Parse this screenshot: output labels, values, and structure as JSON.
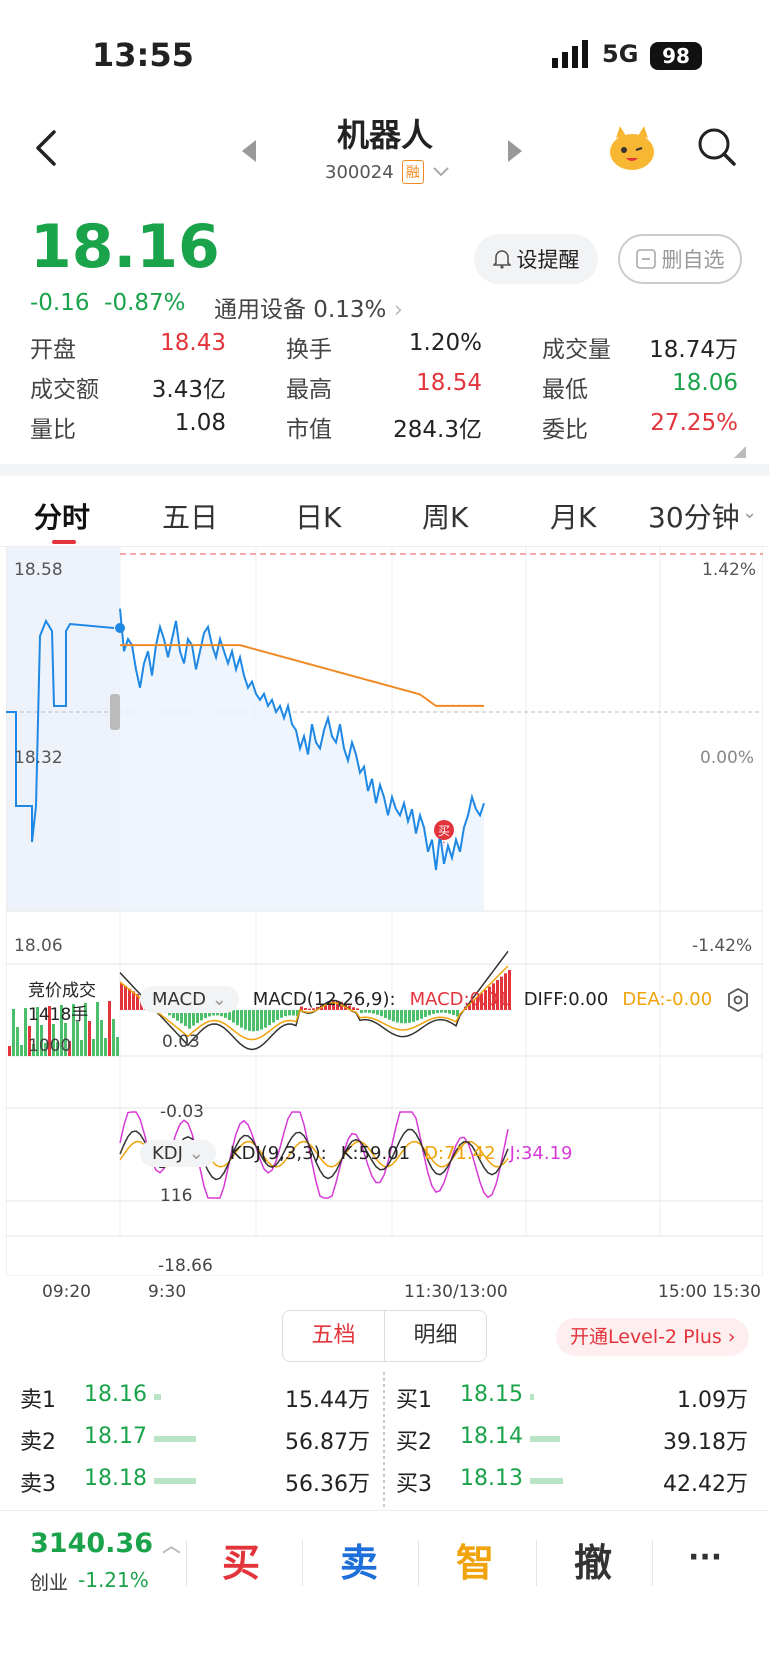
{
  "status": {
    "time": "13:55",
    "network": "5G",
    "battery": "98"
  },
  "header": {
    "title": "机器人",
    "code": "300024",
    "margin_tag": "融"
  },
  "quote": {
    "price": "18.16",
    "change": "-0.16",
    "change_pct": "-0.87%",
    "sector": "通用设备 0.13%",
    "alert_label": "设提醒",
    "remove_fav_label": "删自选"
  },
  "stats": [
    {
      "label": "开盘",
      "value": "18.43",
      "color": "#e3343b"
    },
    {
      "label": "换手",
      "value": "1.20%",
      "color": "#222222"
    },
    {
      "label": "成交量",
      "value": "18.74万",
      "color": "#222222"
    },
    {
      "label": "成交额",
      "value": "3.43亿",
      "color": "#222222"
    },
    {
      "label": "最高",
      "value": "18.54",
      "color": "#e3343b"
    },
    {
      "label": "最低",
      "value": "18.06",
      "color": "#1aa34a"
    },
    {
      "label": "量比",
      "value": "1.08",
      "color": "#222222"
    },
    {
      "label": "市值",
      "value": "284.3亿",
      "color": "#222222"
    },
    {
      "label": "委比",
      "value": "27.25%",
      "color": "#e3343b"
    }
  ],
  "tabs": [
    "分时",
    "五日",
    "日K",
    "周K",
    "月K",
    "30分钟"
  ],
  "chart": {
    "y_top": "18.58",
    "y_mid": "18.32",
    "y_bottom": "18.06",
    "pct_top": "1.42%",
    "pct_mid": "0.00%",
    "pct_bottom": "-1.42%",
    "auction_label": "竞价成交",
    "auction_volume": "1418手",
    "vol_label": "1000",
    "macd_name": "MACD",
    "macd_params": "MACD(12,26,9):",
    "macd_value": "MACD:0.01",
    "diff_value": "DIFF:0.00",
    "dea_value": "DEA:-0.00",
    "macd_pos": "0.03",
    "macd_neg": "-0.03",
    "kdj_name": "KDJ",
    "kdj_params": "KDJ(9,3,3):",
    "k_value": "K:59.01",
    "d_value": "D:71.42",
    "j_value": "J:34.19",
    "kdj_top": "116",
    "kdj_bottom": "-18.66",
    "buy_marker": "买",
    "time_labels": [
      "09:20",
      "9:30",
      "11:30/13:00",
      "15:00",
      "15:30"
    ]
  },
  "orderbook": {
    "tab_active": "五档",
    "tab_other": "明细",
    "level2": "开通Level-2 Plus",
    "sell": [
      {
        "label": "卖1",
        "price": "18.16",
        "vol": "15.44万",
        "bar": 0.12
      },
      {
        "label": "卖2",
        "price": "18.17",
        "vol": "56.87万",
        "bar": 0.7
      },
      {
        "label": "卖3",
        "price": "18.18",
        "vol": "56.36万",
        "bar": 0.7
      }
    ],
    "buy": [
      {
        "label": "买1",
        "price": "18.15",
        "vol": "1.09万",
        "bar": 0.02
      },
      {
        "label": "买2",
        "price": "18.14",
        "vol": "39.18万",
        "bar": 0.5
      },
      {
        "label": "买3",
        "price": "18.13",
        "vol": "42.42万",
        "bar": 0.55
      }
    ]
  },
  "bottom": {
    "index_value": "3140.36",
    "index_name": "创业",
    "index_change": "-1.21%",
    "buy": "买",
    "sell": "卖",
    "smart": "智",
    "cancel": "撤",
    "more": "···"
  },
  "colors": {
    "up": "#e3343b",
    "down": "#1aa34a",
    "price_line": "#1e88e5",
    "avg_line": "#f08a24"
  }
}
